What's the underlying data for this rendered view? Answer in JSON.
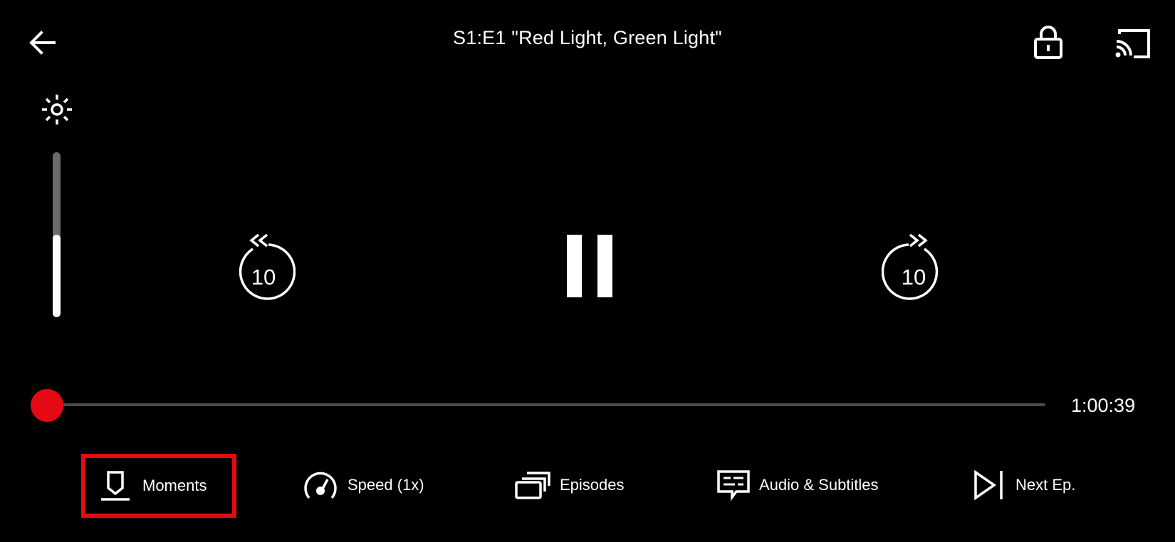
{
  "header": {
    "episode_title": "S1:E1 \"Red Light, Green Light\"",
    "back_icon": "arrow-left-icon",
    "lock_icon": "lock-icon",
    "cast_icon": "cast-icon"
  },
  "brightness": {
    "icon": "brightness-icon",
    "level": 0.5
  },
  "controls": {
    "rewind_label": "10",
    "forward_label": "10",
    "rewind_icon": "rewind-10-icon",
    "forward_icon": "forward-10-icon",
    "pause_icon": "pause-icon"
  },
  "progress": {
    "fraction": 0.0,
    "time_remaining": "1:00:39"
  },
  "bottom_bar": {
    "moments_label": "Moments",
    "speed_label": "Speed (1x)",
    "episodes_label": "Episodes",
    "audio_subtitles_label": "Audio & Subtitles",
    "next_episode_label": "Next Ep."
  },
  "colors": {
    "accent": "#e50914",
    "background": "#000000",
    "foreground": "#ffffff"
  }
}
